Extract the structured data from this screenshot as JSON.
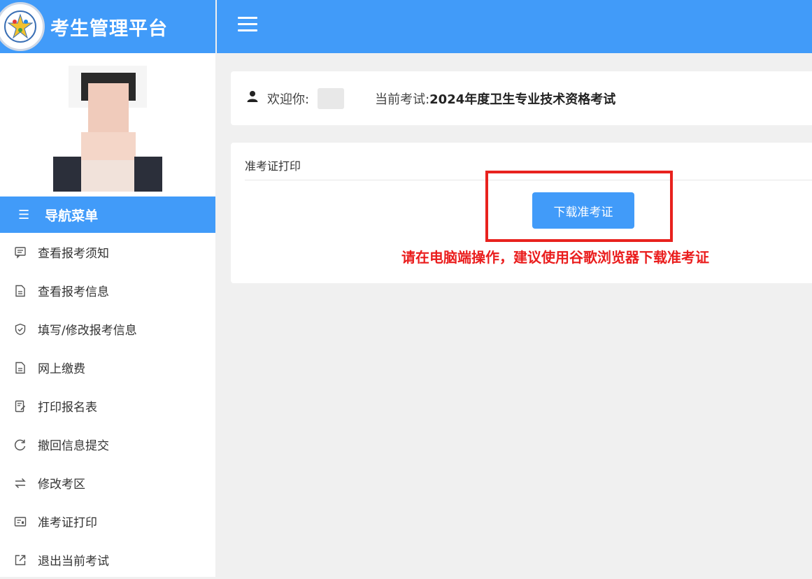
{
  "brand": {
    "title": "考生管理平台"
  },
  "nav": {
    "header": "导航菜单",
    "items": [
      {
        "label": "查看报考须知",
        "icon": "message-icon"
      },
      {
        "label": "查看报考信息",
        "icon": "document-icon"
      },
      {
        "label": "填写/修改报考信息",
        "icon": "shield-check-icon"
      },
      {
        "label": "网上缴费",
        "icon": "document-icon"
      },
      {
        "label": "打印报名表",
        "icon": "edit-list-icon"
      },
      {
        "label": "撤回信息提交",
        "icon": "refresh-icon"
      },
      {
        "label": "修改考区",
        "icon": "swap-icon"
      },
      {
        "label": "准考证打印",
        "icon": "ticket-icon"
      },
      {
        "label": "退出当前考试",
        "icon": "exit-icon"
      }
    ]
  },
  "welcome": {
    "label": "欢迎你:",
    "exam_label": "当前考试:",
    "exam_name": "2024年度卫生专业技术资格考试"
  },
  "panel": {
    "title": "准考证打印",
    "button": "下载准考证",
    "warning": "请在电脑端操作，建议使用谷歌浏览器下载准考证"
  },
  "colors": {
    "primary": "#419bf9",
    "warning": "#ea1d1d"
  }
}
